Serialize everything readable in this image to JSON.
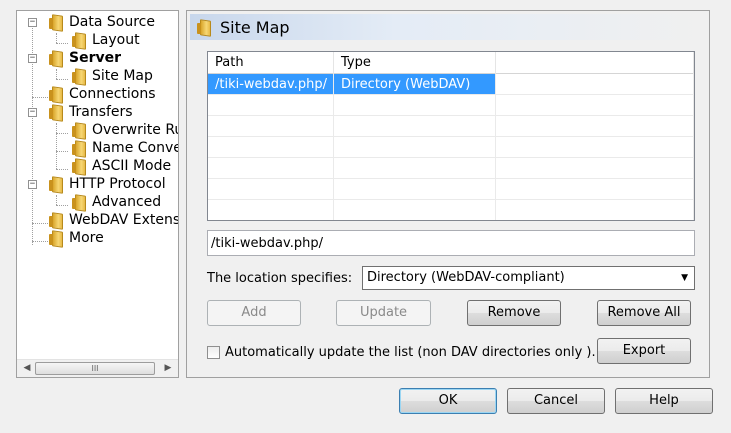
{
  "tree": {
    "items": [
      {
        "label": "Data Source",
        "bold": false
      },
      {
        "label": "Layout",
        "bold": false
      },
      {
        "label": "Server",
        "bold": true
      },
      {
        "label": "Site Map",
        "bold": false
      },
      {
        "label": "Connections",
        "bold": false
      },
      {
        "label": "Transfers",
        "bold": false
      },
      {
        "label": "Overwrite Rul",
        "bold": false
      },
      {
        "label": "Name Conver",
        "bold": false
      },
      {
        "label": "ASCII Mode",
        "bold": false
      },
      {
        "label": "HTTP Protocol",
        "bold": false
      },
      {
        "label": "Advanced",
        "bold": false
      },
      {
        "label": "WebDAV Extensi",
        "bold": false
      },
      {
        "label": "More",
        "bold": false
      }
    ],
    "expander_minus": "−",
    "scroll_left": "◀",
    "scroll_right": "▶",
    "scroll_thumb": "III"
  },
  "panel": {
    "title": "Site Map"
  },
  "sitemap": {
    "columns": [
      "Path",
      "Type"
    ],
    "rows": [
      {
        "path": "/tiki-webdav.php/",
        "type": "Directory (WebDAV)"
      }
    ]
  },
  "path_input": {
    "value": "/tiki-webdav.php/"
  },
  "location": {
    "label": "The location specifies:",
    "selected": "Directory (WebDAV-compliant)",
    "caret": "▼"
  },
  "buttons": {
    "add": "Add",
    "update": "Update",
    "remove": "Remove",
    "remove_all": "Remove All",
    "export": "Export",
    "ok": "OK",
    "cancel": "Cancel",
    "help": "Help"
  },
  "auto_update": {
    "label": "Automatically update the list (non DAV directories only )."
  },
  "colors": {
    "selection": "#3399ff",
    "header_gradient": "#c8d7ec"
  }
}
